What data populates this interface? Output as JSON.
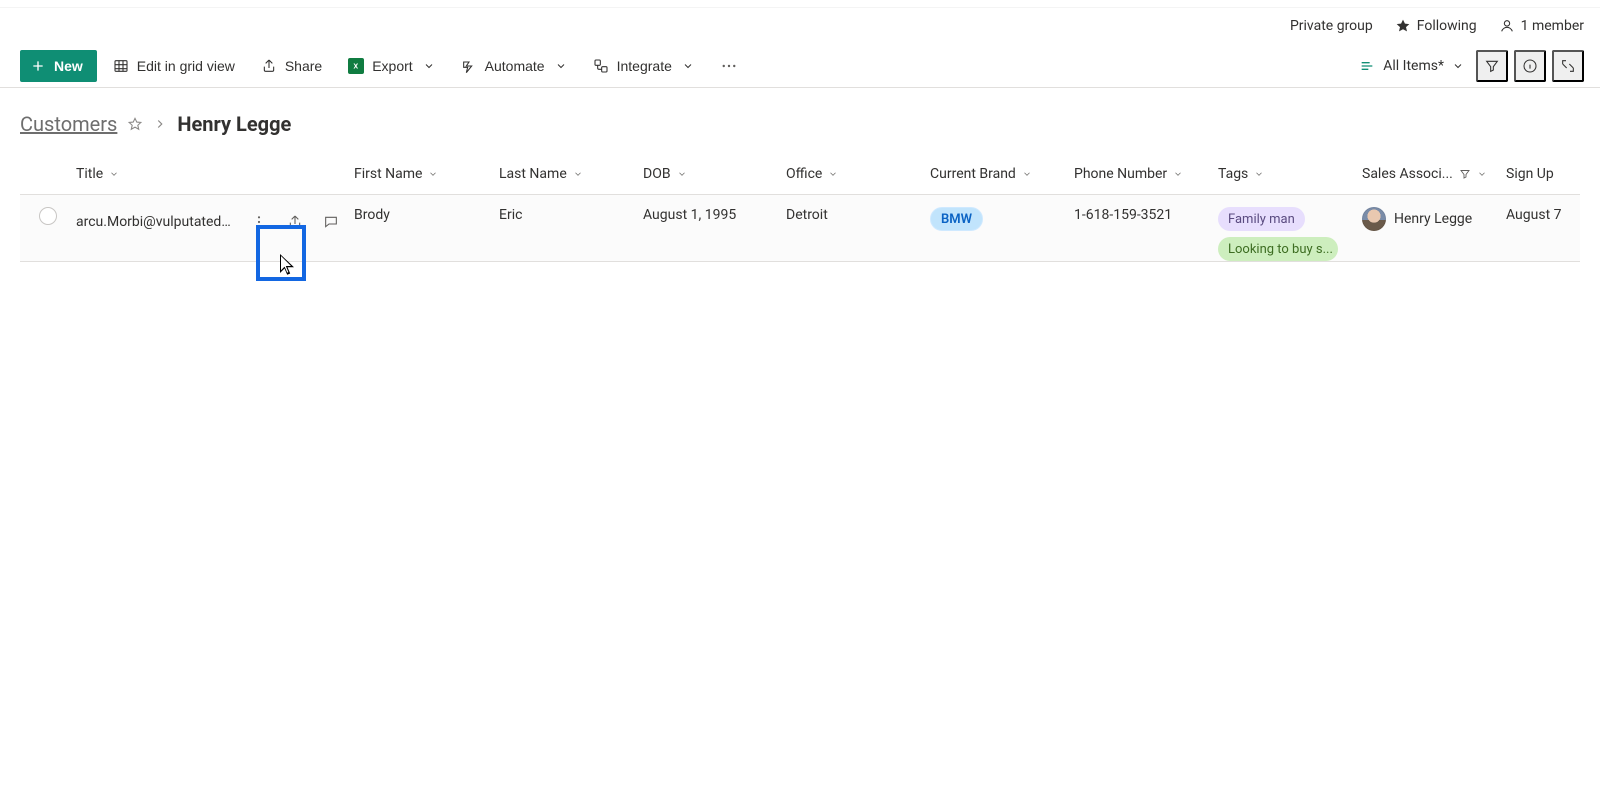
{
  "info": {
    "private_group": "Private group",
    "following": "Following",
    "members": "1 member"
  },
  "cmd": {
    "new": "New",
    "edit_in_grid": "Edit in grid view",
    "share": "Share",
    "export": "Export",
    "automate": "Automate",
    "integrate": "Integrate",
    "all_items": "All Items*"
  },
  "breadcrumb": {
    "root": "Customers",
    "leaf": "Henry Legge"
  },
  "columns": {
    "title": "Title",
    "first_name": "First Name",
    "last_name": "Last Name",
    "dob": "DOB",
    "office": "Office",
    "brand": "Current Brand",
    "phone": "Phone Number",
    "tags": "Tags",
    "sales_assoc": "Sales Associ...",
    "sign_up": "Sign Up"
  },
  "rows": [
    {
      "title": "arcu.Morbi@vulputatedui...",
      "first_name": "Brody",
      "last_name": "Eric",
      "dob": "August 1, 1995",
      "office": "Detroit",
      "brand": "BMW",
      "phone": "1-618-159-3521",
      "tags": [
        "Family man",
        "Looking to buy s..."
      ],
      "sales_assoc": "Henry Legge",
      "sign_up": "August 7"
    }
  ]
}
